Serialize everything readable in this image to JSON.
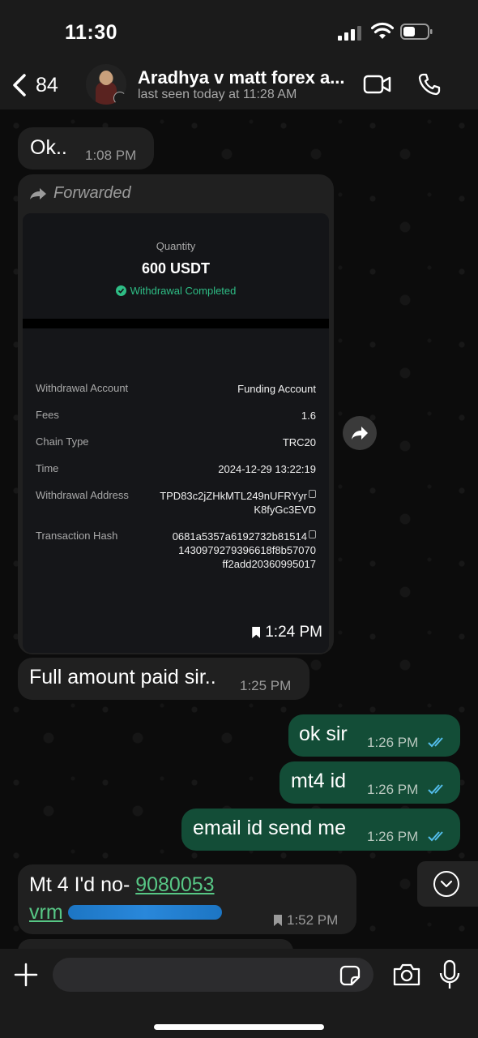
{
  "status_bar": {
    "time": "11:30"
  },
  "header": {
    "back_count": "84",
    "contact_name": "Aradhya v matt forex a...",
    "last_seen": "last seen today at 11:28 AM"
  },
  "messages": [
    {
      "text": "Ok..",
      "time": "1:08 PM"
    },
    {
      "forwarded_label": "Forwarded",
      "card": {
        "quantity_label": "Quantity",
        "quantity_value": "600 USDT",
        "status": "Withdrawal Completed",
        "rows": [
          {
            "label": "Withdrawal Account",
            "value": "Funding Account"
          },
          {
            "label": "Fees",
            "value": "1.6"
          },
          {
            "label": "Chain Type",
            "value": "TRC20"
          },
          {
            "label": "Time",
            "value": "2024-12-29 13:22:19"
          },
          {
            "label": "Withdrawal Address",
            "value_line1": "TPD83c2jZHkMTL249nUFRYyr",
            "value_line2": "K8fyGc3EVD"
          },
          {
            "label": "Transaction Hash",
            "value_line1": "0681a5357a6192732b81514",
            "value_line2": "1430979279396618f8b57070",
            "value_line3": "ff2add20360995017"
          }
        ]
      },
      "time": "1:24 PM"
    },
    {
      "text": "Full amount paid sir..",
      "time": "1:25 PM"
    },
    {
      "text": "ok sir",
      "time": "1:26 PM"
    },
    {
      "text": "mt4 id",
      "time": "1:26 PM"
    },
    {
      "text": "email id send me",
      "time": "1:26 PM"
    },
    {
      "text_prefix": "Mt 4 I'd no- ",
      "link_number": "9080053",
      "link_line2": "vrm",
      "time": "1:52 PM"
    }
  ],
  "colors": {
    "incoming_bubble": "#202020",
    "outgoing_bubble": "#134d37",
    "link_green": "#57c785",
    "status_green": "#2ebd85",
    "read_ticks": "#53bdeb"
  },
  "input": {
    "placeholder": ""
  }
}
